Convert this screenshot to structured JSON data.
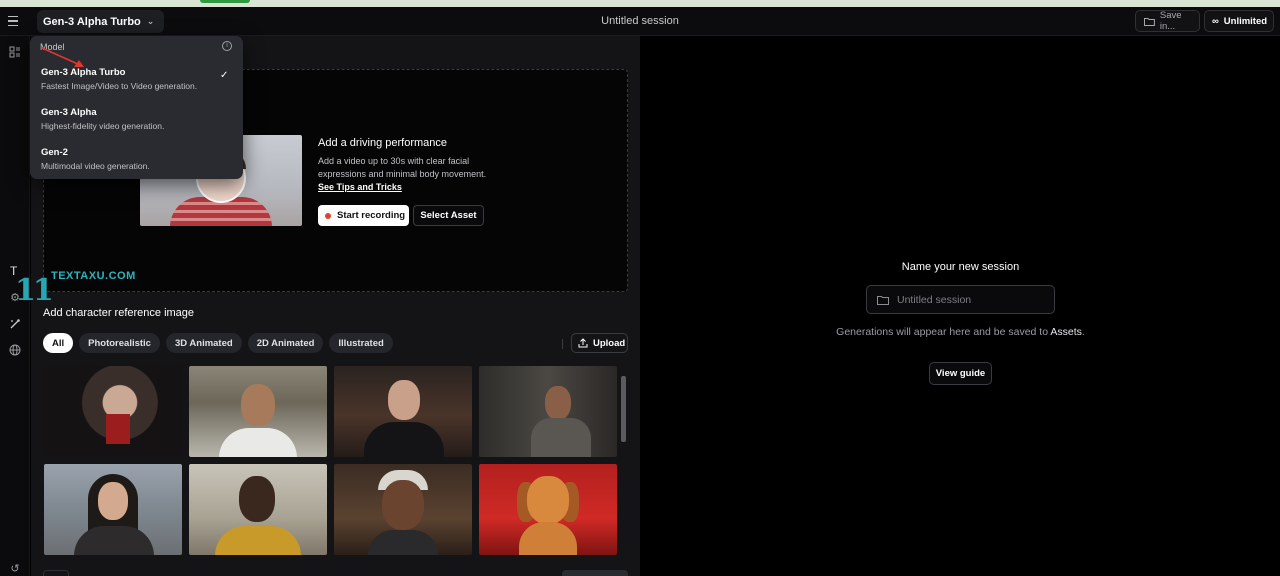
{
  "topbar": {
    "model_button": "Gen-3 Alpha Turbo",
    "session_title": "Untitled session",
    "save_label": "Save in...",
    "plan_label": "Unlimited"
  },
  "model_menu": {
    "heading": "Model",
    "items": [
      {
        "name": "Gen-3 Alpha Turbo",
        "desc": "Fastest Image/Video to Video generation.",
        "selected": true
      },
      {
        "name": "Gen-3 Alpha",
        "desc": "Highest-fidelity video generation."
      },
      {
        "name": "Gen-2",
        "desc": "Multimodal video generation."
      }
    ]
  },
  "performance": {
    "title": "Add a driving performance",
    "description": "Add a video up to 30s with clear facial expressions and minimal body movement.",
    "tips_link": "See Tips and Tricks",
    "record_button": "Start recording",
    "asset_button": "Select Asset"
  },
  "character": {
    "title": "Add character reference image",
    "filters": [
      "All",
      "Photorealistic",
      "3D Animated",
      "2D Animated",
      "Illustrated"
    ],
    "active_filter": "All",
    "upload_button": "Upload"
  },
  "session_panel": {
    "title": "Name your new session",
    "input_placeholder": "Untitled session",
    "note_prefix": "Generations will appear here and be saved to ",
    "note_link": "Assets",
    "note_suffix": ".",
    "guide_button": "View guide"
  },
  "watermark": {
    "number": "11",
    "text": "TEXTAXU.COM",
    "letter": "T"
  },
  "colors": {
    "background": "#000000",
    "panel": "#141417",
    "menu": "#2a2b30",
    "record_dot": "#e0442f",
    "annotation": "#e0362c",
    "watermark": "#28a7b2"
  }
}
